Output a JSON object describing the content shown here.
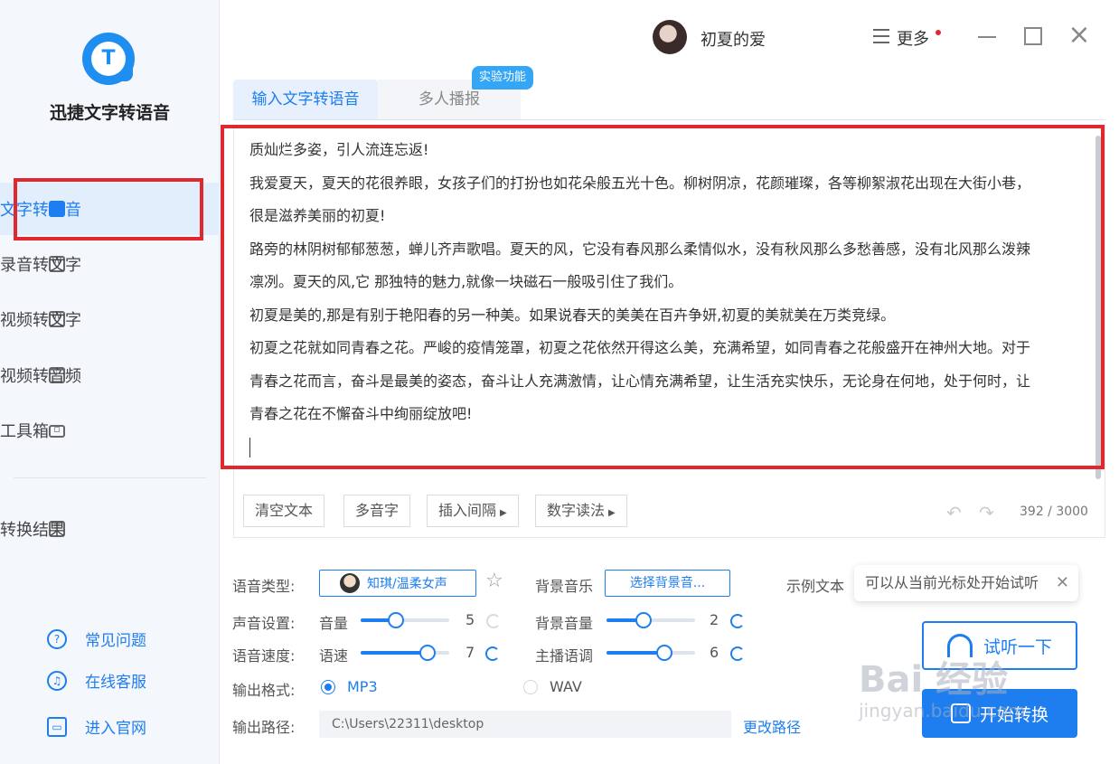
{
  "app": {
    "name": "迅捷文字转语音"
  },
  "nav": {
    "items": [
      {
        "label": "文字转语音",
        "icon": "text-to-speech-icon",
        "active": true
      },
      {
        "label": "录音转文字",
        "icon": "recording-to-text-icon",
        "active": false
      },
      {
        "label": "视频转文字",
        "icon": "video-to-text-icon",
        "active": false
      },
      {
        "label": "视频转音频",
        "icon": "video-to-audio-icon",
        "active": false
      },
      {
        "label": "工具箱",
        "icon": "toolbox-icon",
        "active": false
      },
      {
        "label": "转换结果",
        "icon": "results-icon",
        "active": false
      }
    ],
    "help": [
      {
        "label": "常见问题",
        "icon": "question-icon",
        "glyph": "?"
      },
      {
        "label": "在线客服",
        "icon": "headset-icon",
        "glyph": "♫"
      },
      {
        "label": "进入官网",
        "icon": "monitor-icon",
        "glyph": "▭"
      }
    ]
  },
  "header": {
    "username": "初夏的爱",
    "more_label": "更多"
  },
  "tabs": [
    {
      "label": "输入文字转语音",
      "active": true
    },
    {
      "label": "多人播报",
      "active": false
    }
  ],
  "lab_badge": "实验功能",
  "editor": {
    "lines": [
      "质灿烂多姿，引人流连忘返!",
      "我爱夏天，夏天的花很养眼，女孩子们的打扮也如花朵般五光十色。柳树阴凉，花颜璀璨，各等柳絮淑花出现在大街小巷，",
      "很是滋养美丽的初夏!",
      "路旁的林阴树郁郁葱葱，蝉儿齐声歌唱。夏天的风，它没有春风那么柔情似水，没有秋风那么多愁善感，没有北风那么泼辣",
      "凛冽。夏天的风,它 那独特的魅力,就像一块磁石一般吸引住了我们。",
      "初夏是美的,那是有别于艳阳春的另一种美。如果说春天的美美在百卉争妍,初夏的美就美在万类竞绿。",
      "初夏之花就如同青春之花。严峻的疫情笼罩，初夏之花依然开得这么美，充满希望，如同青春之花般盛开在神州大地。对于",
      "青春之花而言，奋斗是最美的姿态，奋斗让人充满激情，让心情充满希望，让生活充实快乐，无论身在何地，处于何时，让",
      "青春之花在不懈奋斗中绚丽绽放吧!"
    ],
    "char_count": "392 / 3000"
  },
  "toolbar": {
    "clear": "清空文本",
    "polyphone": "多音字",
    "insert_pause": "插入间隔",
    "number_reading": "数字读法"
  },
  "settings": {
    "voice_type_label": "语音类型:",
    "voice_value": "知琪/温柔女声",
    "bgm_label": "背景音乐",
    "bgm_button": "选择背景音...",
    "sample_label": "示例文本",
    "tooltip_text": "可以从当前光标处开始试听",
    "sound_label": "声音设置:",
    "volume_label": "音量",
    "volume_value": "5",
    "volume_level": 0.4,
    "bg_volume_label": "背景音量",
    "bg_volume_value": "2",
    "bg_volume_level": 0.42,
    "speed_section_label": "语音速度:",
    "speed_label": "语速",
    "speed_value": "7",
    "speed_level": 0.75,
    "pitch_label": "主播语调",
    "pitch_value": "6",
    "pitch_level": 0.65,
    "format_label": "输出格式:",
    "format_mp3": "MP3",
    "format_wav": "WAV",
    "format_selected": "MP3",
    "path_label": "输出路径:",
    "path_value": "C:\\Users\\22311\\desktop",
    "change_path": "更改路径"
  },
  "actions": {
    "listen": "试听一下",
    "start": "开始转换"
  },
  "watermark": {
    "brand": "Bai 经验",
    "url": "jingyan.baidu.com"
  },
  "colors": {
    "accent": "#1e7ef0",
    "highlight": "#e0282e",
    "sidebar_bg": "#f4f7fc"
  }
}
